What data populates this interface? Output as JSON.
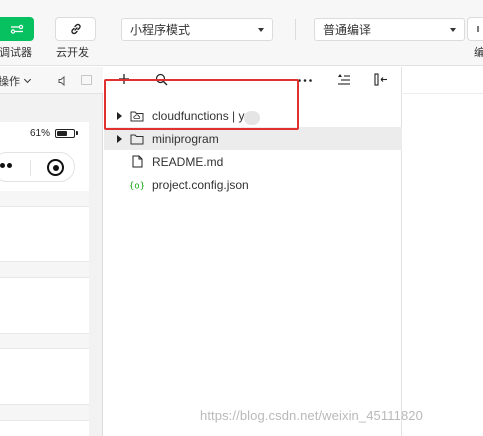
{
  "toolbar": {
    "debugger_label": "调试器",
    "cloud_label": "云开发",
    "right_label": "编",
    "mode_select": {
      "value": "小程序模式"
    },
    "compile_select": {
      "value": "普通编译"
    }
  },
  "simulator": {
    "ops_label": "操作",
    "battery_percent": "61%",
    "battery_level": 0.61
  },
  "file_tree": {
    "items": [
      {
        "label": "cloudfunctions | y",
        "type": "folder-cloud",
        "expandable": true
      },
      {
        "label": "miniprogram",
        "type": "folder",
        "expandable": true
      },
      {
        "label": "README.md",
        "type": "file",
        "expandable": false
      },
      {
        "label": "project.config.json",
        "type": "json",
        "expandable": false
      }
    ]
  },
  "watermark": "https://blog.csdn.net/weixin_45111820",
  "colors": {
    "accent_green": "#07c160",
    "highlight_red": "#e03030",
    "json_icon_green": "#1aad19"
  }
}
